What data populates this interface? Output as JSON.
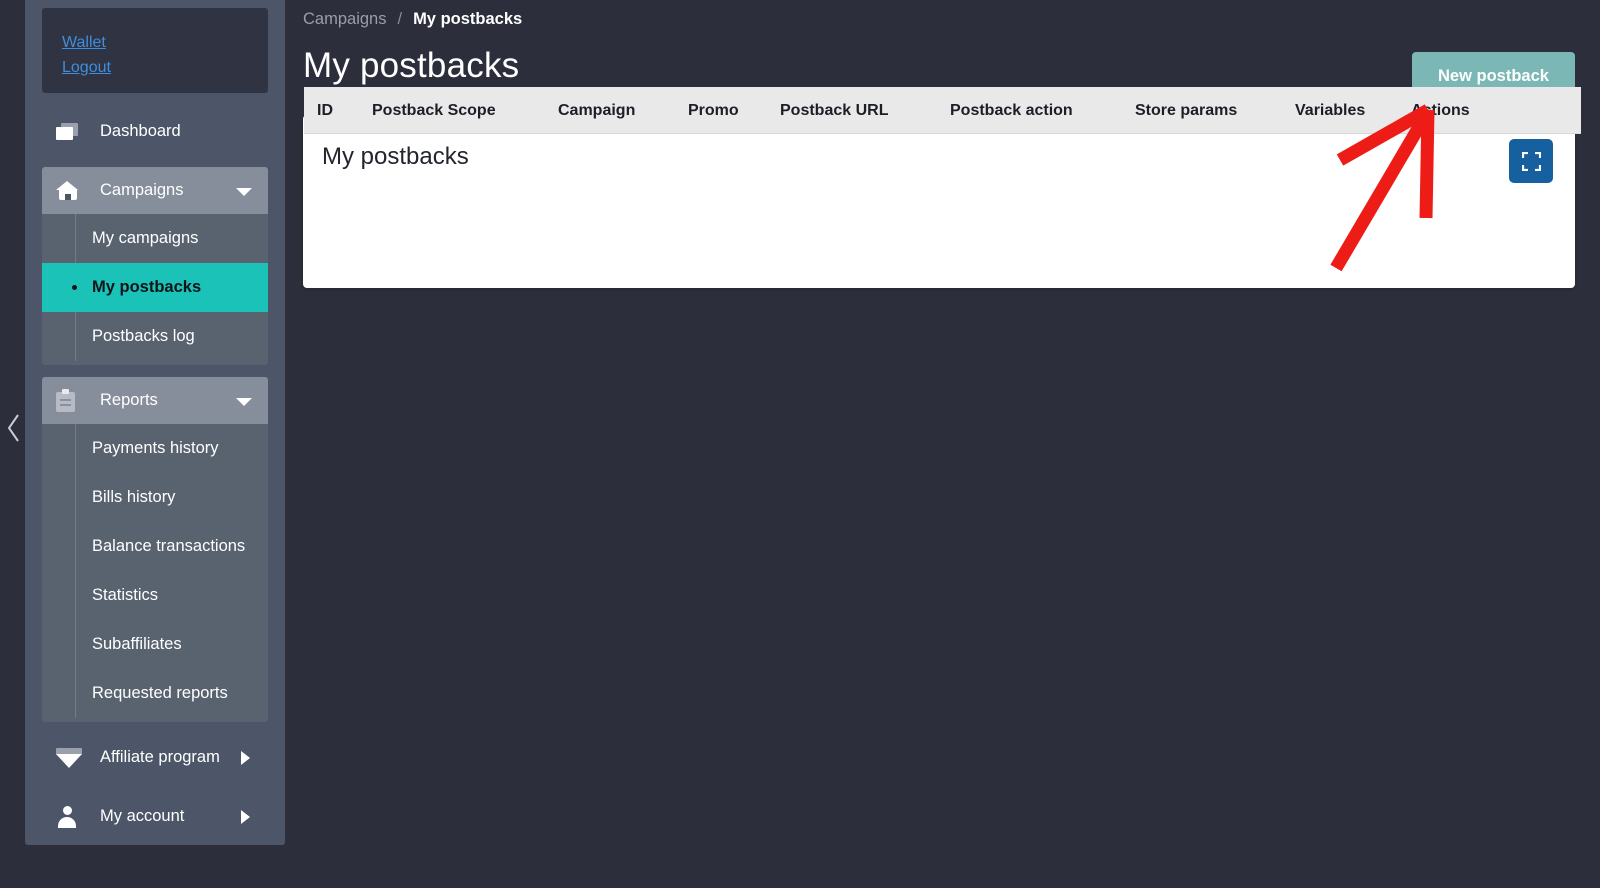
{
  "sidebar": {
    "account_links": [
      {
        "label": "Wallet",
        "name": "wallet-link"
      },
      {
        "label": "Logout",
        "name": "logout-link"
      }
    ],
    "dashboard": {
      "label": "Dashboard",
      "icon": "window-icon"
    },
    "campaigns": {
      "label": "Campaigns",
      "icon": "house-icon",
      "expanded": true,
      "items": [
        {
          "label": "My campaigns",
          "active": false
        },
        {
          "label": "My postbacks",
          "active": true
        },
        {
          "label": "Postbacks log",
          "active": false
        }
      ]
    },
    "reports": {
      "label": "Reports",
      "icon": "clipboard-icon",
      "expanded": true,
      "items": [
        {
          "label": "Payments history",
          "active": false
        },
        {
          "label": "Bills history",
          "active": false
        },
        {
          "label": "Balance transactions",
          "active": false
        },
        {
          "label": "Statistics",
          "active": false
        },
        {
          "label": "Subaffiliates",
          "active": false
        },
        {
          "label": "Requested reports",
          "active": false
        }
      ]
    },
    "affiliate_program": {
      "label": "Affiliate program",
      "icon": "gem-icon",
      "expanded": false
    },
    "my_account": {
      "label": "My account",
      "icon": "person-icon",
      "expanded": false
    },
    "collapse_icon": "chevron-left-icon"
  },
  "breadcrumb": {
    "parent": "Campaigns",
    "separator": "/",
    "current": "My postbacks"
  },
  "header": {
    "title": "My postbacks",
    "new_button": "New postback"
  },
  "card": {
    "title": "My postbacks",
    "fullscreen_icon": "fullscreen-icon",
    "table": {
      "columns": [
        "ID",
        "Postback Scope",
        "Campaign",
        "Promo",
        "Postback URL",
        "Postback action",
        "Store params",
        "Variables",
        "Actions"
      ],
      "rows": []
    }
  },
  "annotation": {
    "type": "arrow",
    "color": "#ee1c16",
    "points_to": "New postback"
  },
  "colors": {
    "page_background": "#2c2e3b",
    "sidebar_background": "#4c5668",
    "sidebar_group_header": "#868d9b",
    "sidebar_submenu": "#59626f",
    "active_item": "#1bc2b8",
    "new_button": "#7bb8b5",
    "fullscreen_button": "#17609f",
    "link_blue": "#3f8ede",
    "table_header": "#e9e9e9",
    "annotation_red": "#ee1c16"
  }
}
